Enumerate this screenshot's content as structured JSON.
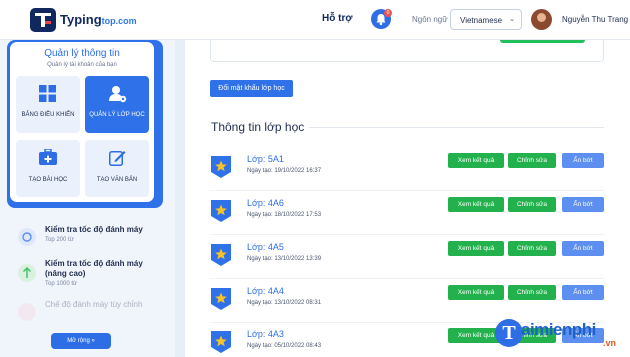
{
  "header": {
    "brand_name": "Typing",
    "brand_domain": "top.com",
    "nav_help": "Hỗ trợ",
    "notification_count": "0",
    "language_label": "Ngôn ngữ",
    "language_value": "Vietnamese",
    "user_name": "Nguyễn Thu Trang"
  },
  "sidebar": {
    "card_title": "Quản lý thông tin",
    "card_subtitle": "Quản lý tài khoản của bạn",
    "tiles": [
      {
        "label": "BẢNG ĐIỀU KHIỂN",
        "icon": "grid-icon"
      },
      {
        "label": "QUẢN LÝ LỚP HỌC",
        "icon": "user-gear-icon"
      },
      {
        "label": "TẠO BÀI HỌC",
        "icon": "briefcase-plus-icon"
      },
      {
        "label": "TẠO VĂN BẢN",
        "icon": "edit-icon"
      }
    ],
    "menu": [
      {
        "title": "Kiểm tra tốc độ đánh máy",
        "subtitle": "Top 200 từ"
      },
      {
        "title": "Kiểm tra tốc độ đánh máy (nâng cao)",
        "subtitle": "Top 1000 từ"
      },
      {
        "title": "Chế độ đánh máy tùy chỉnh",
        "subtitle": ""
      }
    ],
    "more_label": "Mở rộng »"
  },
  "main": {
    "change_password_label": "Đổi mật khẩu lớp học",
    "section_title": "Thông tin lớp học",
    "buttons": {
      "view": "Xem kết quả",
      "edit": "Chỉnh sửa",
      "hide": "Ẩn bớt"
    },
    "classes": [
      {
        "name": "Lớp: 5A1",
        "created": "Ngày tạo: 19/10/2022 16:37"
      },
      {
        "name": "Lớp: 4A6",
        "created": "Ngày tạo: 18/10/2022 17:53"
      },
      {
        "name": "Lớp: 4A5",
        "created": "Ngày tạo: 13/10/2022 13:39"
      },
      {
        "name": "Lớp: 4A4",
        "created": "Ngày tạo: 13/10/2022 08:31"
      },
      {
        "name": "Lớp: 4A3",
        "created": "Ngày tạo: 05/10/2022 08:43"
      }
    ]
  },
  "watermark": {
    "text": "aimienphi",
    "letter": "T",
    "suffix": ".vn"
  },
  "colors": {
    "primary": "#2f71e9",
    "green": "#22b14c",
    "light_blue": "#5d8ff0"
  }
}
